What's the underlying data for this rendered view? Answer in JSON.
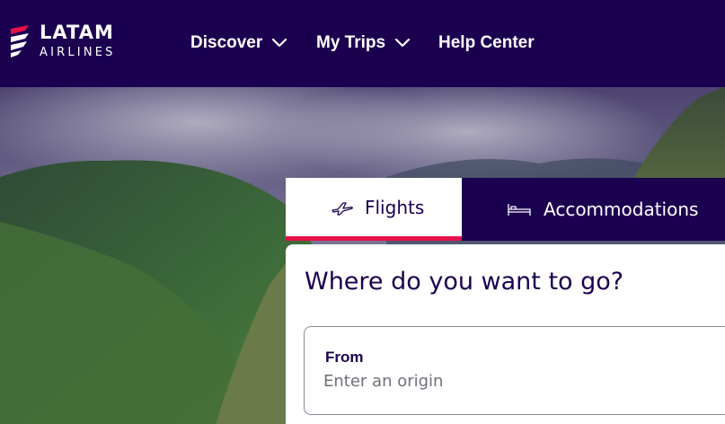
{
  "brand": {
    "name": "LATAM",
    "tagline": "AIRLINES"
  },
  "nav": [
    {
      "label": "Discover",
      "icon": "chevron-down-icon"
    },
    {
      "label": "My Trips",
      "icon": "chevron-down-icon"
    },
    {
      "label": "Help Center"
    }
  ],
  "tabs": {
    "flights": {
      "label": "Flights",
      "icon": "airplane-icon",
      "selected": true
    },
    "accommodations": {
      "label": "Accommodations",
      "icon": "bed-icon",
      "selected": false
    }
  },
  "search": {
    "title": "Where do you want to go?",
    "from_label": "From",
    "from_placeholder": "Enter an origin",
    "from_value": ""
  },
  "colors": {
    "brand_navy": "#1b0050",
    "accent": "#e8114b",
    "white": "#ffffff"
  }
}
